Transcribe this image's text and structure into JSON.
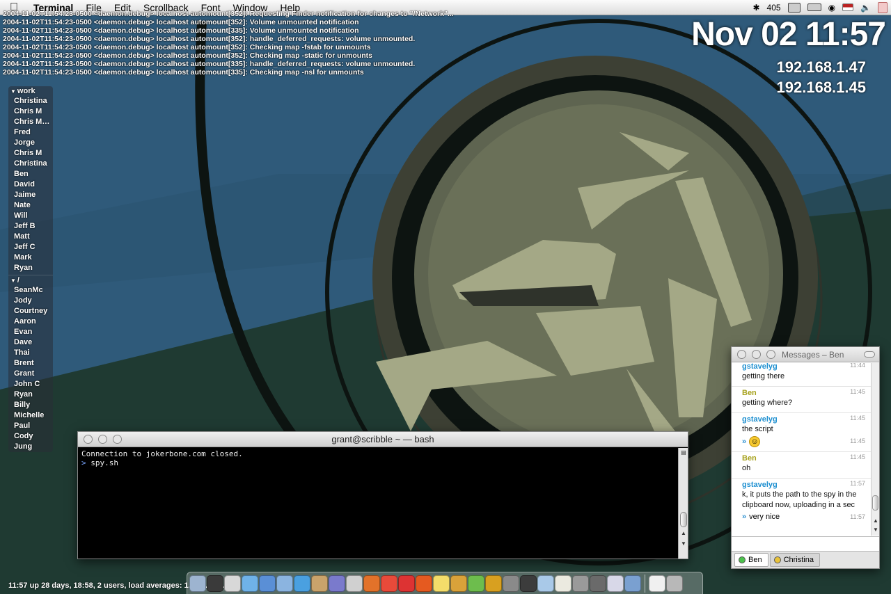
{
  "menubar": {
    "app_name": "Terminal",
    "menus": [
      "File",
      "Edit",
      "Scrollback",
      "Font",
      "Window",
      "Help"
    ],
    "status": {
      "counter": "405",
      "icons": [
        "bluetooth-icon",
        "display-icon",
        "battery-icon",
        "wifi-icon",
        "flag-icon",
        "volume-icon",
        "user-icon"
      ]
    }
  },
  "console_log": [
    "2004-11-02T11:54:23-0500 <daemon.debug> localhost automount[352]: Requesting Finder notification for changes to \"/Network\"...",
    "2004-11-02T11:54:23-0500 <daemon.debug> localhost automount[352]: Volume unmounted notification",
    "2004-11-02T11:54:23-0500 <daemon.debug> localhost automount[335]: Volume unmounted notification",
    "2004-11-02T11:54:23-0500 <daemon.debug> localhost automount[352]: handle_deferred_requests: volume unmounted.",
    "2004-11-02T11:54:23-0500 <daemon.debug> localhost automount[352]: Checking map -fstab for unmounts",
    "2004-11-02T11:54:23-0500 <daemon.debug> localhost automount[352]: Checking map -static for unmounts",
    "2004-11-02T11:54:23-0500 <daemon.debug> localhost automount[335]: handle_deferred_requests: volume unmounted.",
    "2004-11-02T11:54:23-0500 <daemon.debug> localhost automount[335]: Checking map -nsl for unmounts"
  ],
  "clock": "Nov 02 11:57",
  "ips": [
    "192.168.1.47",
    "192.168.1.45"
  ],
  "buddy_list": {
    "groups": [
      {
        "name": "work",
        "buddies": [
          "Christina",
          "Chris M",
          "Chris M…",
          "Fred",
          "Jorge",
          "Chris M",
          "Christina",
          "Ben",
          "David",
          "Jaime",
          "Nate",
          "Will",
          "Jeff B",
          "Matt",
          "Jeff C",
          "Mark",
          "Ryan"
        ]
      },
      {
        "name": "/",
        "buddies": [
          "SeanMc",
          "Jody",
          "Courtney",
          "Aaron",
          "Evan",
          "Dave",
          "Thai",
          "Brent",
          "Grant",
          "John C",
          "Ryan",
          "Billy",
          "Michelle",
          "Paul",
          "Cody",
          "Jung"
        ]
      }
    ]
  },
  "terminal": {
    "title": "grant@scribble ~ — bash",
    "lines": [
      {
        "prompt": "",
        "text": "Connection to jokerbone.com closed."
      },
      {
        "prompt": ">",
        "text": "spy.sh"
      }
    ]
  },
  "messages": {
    "title": "Messages – Ben",
    "entries": [
      {
        "sender": "gstavelyg",
        "who": "me",
        "time": "11:44",
        "text": "getting there"
      },
      {
        "sender": "Ben",
        "who": "them",
        "time": "11:45",
        "text": "getting where?"
      },
      {
        "sender": "gstavelyg",
        "who": "me",
        "time": "11:45",
        "text": "the script",
        "sub_time": "11:45",
        "sub_text": "😃"
      },
      {
        "sender": "Ben",
        "who": "them",
        "time": "11:45",
        "text": "oh"
      },
      {
        "sender": "gstavelyg",
        "who": "me",
        "time": "11:57",
        "text": "k, it puts the path to the spy in the clipboard now, uploading in a sec",
        "sub_time": "11:57",
        "sub_text": "very nice"
      }
    ],
    "tabs": [
      {
        "label": "Ben",
        "status": "green",
        "active": true
      },
      {
        "label": "Christina",
        "status": "yellow",
        "active": false
      }
    ]
  },
  "uptime": "11:57  up 28 days, 18:58, 2 users, load averages: 1.20 1.24 2.02",
  "colors": {
    "sky": "#2f5a7a",
    "ground": "#1f3a32",
    "disc": "#3d4034",
    "ring": "#5e6450",
    "figure": "#a4a886",
    "chat_me": "#1d8fd0",
    "chat_them": "#a7a21e"
  },
  "dock": {
    "apps": [
      "finder",
      "terminal",
      "console",
      "itunes",
      "mail",
      "preview",
      "safari",
      "address-book",
      "vpn",
      "textedit",
      "firefox",
      "ical",
      "tomato",
      "flash",
      "stickies",
      "adium",
      "ichat",
      "tv",
      "system-prefs",
      "calculator",
      "dictionary",
      "notes",
      "grab",
      "search",
      "newsreader",
      "photos"
    ],
    "separated": [
      "document",
      "trash"
    ]
  }
}
